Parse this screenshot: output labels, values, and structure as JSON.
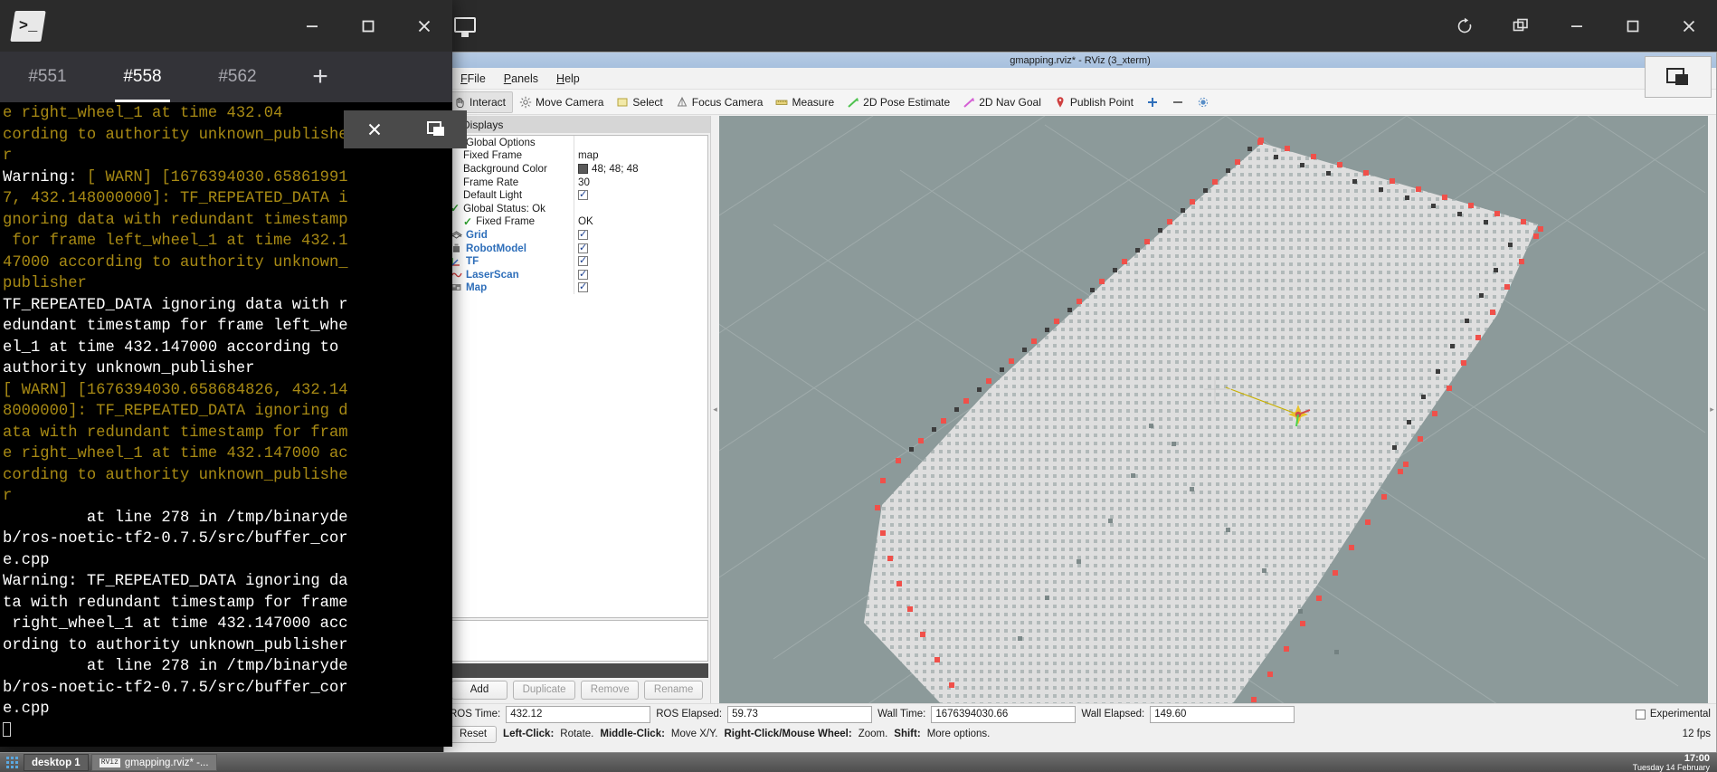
{
  "terminal": {
    "title_icon": "terminal-prompt-icon",
    "window_controls": {
      "minimize": "minimize-icon",
      "maximize": "maximize-icon",
      "close": "close-icon"
    },
    "tabs": [
      {
        "label": "#551",
        "active": false
      },
      {
        "label": "#558",
        "active": true
      },
      {
        "label": "#562",
        "active": false
      }
    ],
    "new_tab_label": "+",
    "overlay_buttons": [
      {
        "name": "close-overlay",
        "glyph": "✕"
      },
      {
        "name": "restore-overlay",
        "glyph": "❐"
      }
    ],
    "lines": [
      {
        "t": "e right_wheel_1 at time 432.04",
        "c": "y"
      },
      {
        "t": "cording to authority unknown_publisher",
        "c": "y"
      },
      {
        "t": "r",
        "c": "y"
      },
      {
        "t": "Warning: ",
        "c": "w",
        "t2": "[ WARN] [1676394030.65861991",
        "c2": "y"
      },
      {
        "t": "7, 432.148000000]: TF_REPEATED_DATA i",
        "c": "y"
      },
      {
        "t": "gnoring data with redundant timestamp",
        "c": "y"
      },
      {
        "t": " for frame left_wheel_1 at time 432.1",
        "c": "y"
      },
      {
        "t": "47000 according to authority unknown_",
        "c": "y"
      },
      {
        "t": "publisher",
        "c": "y"
      },
      {
        "t": "TF_REPEATED_DATA ignoring data with r",
        "c": "w"
      },
      {
        "t": "edundant timestamp for frame left_whe",
        "c": "w"
      },
      {
        "t": "el_1 at time 432.147000 according to",
        "c": "w"
      },
      {
        "t": "authority unknown_publisher",
        "c": "w"
      },
      {
        "t": "[ WARN] [1676394030.658684826, 432.14",
        "c": "y"
      },
      {
        "t": "8000000]: TF_REPEATED_DATA ignoring d",
        "c": "y"
      },
      {
        "t": "ata with redundant timestamp for fram",
        "c": "y"
      },
      {
        "t": "e right_wheel_1 at time 432.147000 ac",
        "c": "y"
      },
      {
        "t": "cording to authority unknown_publishe",
        "c": "y"
      },
      {
        "t": "r",
        "c": "y"
      },
      {
        "t": "         at line 278 in /tmp/binaryde",
        "c": "w"
      },
      {
        "t": "b/ros-noetic-tf2-0.7.5/src/buffer_cor",
        "c": "w"
      },
      {
        "t": "e.cpp",
        "c": "w"
      },
      {
        "t": "Warning: TF_REPEATED_DATA ignoring da",
        "c": "w"
      },
      {
        "t": "ta with redundant timestamp for frame",
        "c": "w"
      },
      {
        "t": " right_wheel_1 at time 432.147000 acc",
        "c": "w"
      },
      {
        "t": "ording to authority unknown_publisher",
        "c": "w"
      },
      {
        "t": "         at line 278 in /tmp/binaryde",
        "c": "w"
      },
      {
        "t": "b/ros-noetic-tf2-0.7.5/src/buffer_cor",
        "c": "w"
      },
      {
        "t": "e.cpp",
        "c": "w"
      }
    ]
  },
  "rviz": {
    "window_title": "gmapping.rviz* - RViz (3_xterm)",
    "window_controls": {
      "refresh": "refresh-icon",
      "duplicate": "duplicate-window-icon",
      "minimize": "minimize-icon",
      "maximize": "maximize-icon",
      "close": "close-icon"
    },
    "menu": [
      {
        "label": "File",
        "accel": "F"
      },
      {
        "label": "Panels",
        "accel": "P"
      },
      {
        "label": "Help",
        "accel": "H"
      }
    ],
    "toolbar": [
      {
        "label": "Interact",
        "icon": "hand-icon",
        "active": true
      },
      {
        "label": "Move Camera",
        "icon": "camera-move-icon",
        "active": false
      },
      {
        "label": "Select",
        "icon": "select-rect-icon",
        "active": false
      },
      {
        "label": "Focus Camera",
        "icon": "focus-icon",
        "active": false
      },
      {
        "label": "Measure",
        "icon": "ruler-icon",
        "active": false
      },
      {
        "label": "2D Pose Estimate",
        "icon": "pose-arrow-icon",
        "active": false
      },
      {
        "label": "2D Nav Goal",
        "icon": "nav-goal-icon",
        "active": false
      },
      {
        "label": "Publish Point",
        "icon": "publish-point-icon",
        "active": false
      },
      {
        "label": "",
        "icon": "plus-circle-icon",
        "active": false
      },
      {
        "label": "",
        "icon": "minus-icon",
        "active": false
      },
      {
        "label": "",
        "icon": "gear-dot-icon",
        "active": false
      }
    ],
    "displays_panel": {
      "title": "Displays",
      "rows": [
        {
          "name": "Global Options",
          "value": "",
          "indent": 0,
          "icon": "gear-icon",
          "kind": "group"
        },
        {
          "name": "Fixed Frame",
          "value": "map",
          "indent": 1,
          "kind": "text"
        },
        {
          "name": "Background Color",
          "value": "48; 48; 48",
          "indent": 1,
          "kind": "color"
        },
        {
          "name": "Frame Rate",
          "value": "30",
          "indent": 1,
          "kind": "text"
        },
        {
          "name": "Default Light",
          "value": "",
          "indent": 1,
          "kind": "check",
          "checked": true
        },
        {
          "name": "Global Status: Ok",
          "value": "",
          "indent": 0,
          "kind": "status"
        },
        {
          "name": "Fixed Frame",
          "value": "OK",
          "indent": 1,
          "kind": "status-text"
        },
        {
          "name": "Grid",
          "value": "",
          "indent": 0,
          "kind": "display",
          "icon": "grid-icon",
          "checked": true
        },
        {
          "name": "RobotModel",
          "value": "",
          "indent": 0,
          "kind": "display",
          "icon": "robot-icon",
          "checked": true
        },
        {
          "name": "TF",
          "value": "",
          "indent": 0,
          "kind": "display",
          "icon": "tf-axes-icon",
          "checked": true
        },
        {
          "name": "LaserScan",
          "value": "",
          "indent": 0,
          "kind": "display",
          "icon": "laserscan-icon",
          "checked": true
        },
        {
          "name": "Map",
          "value": "",
          "indent": 0,
          "kind": "display",
          "icon": "map-icon",
          "checked": true
        }
      ],
      "buttons": [
        {
          "label": "Add",
          "enabled": true
        },
        {
          "label": "Duplicate",
          "enabled": false
        },
        {
          "label": "Remove",
          "enabled": false
        },
        {
          "label": "Rename",
          "enabled": false
        }
      ]
    },
    "time_panel": {
      "fields": [
        {
          "label": "ROS Time:",
          "value": "432.12"
        },
        {
          "label": "ROS Elapsed:",
          "value": "59.73"
        },
        {
          "label": "Wall Time:",
          "value": "1676394030.66"
        },
        {
          "label": "Wall Elapsed:",
          "value": "149.60"
        }
      ],
      "experimental_label": "Experimental",
      "experimental_checked": false
    },
    "status_bar": {
      "reset_label": "Reset",
      "hints": [
        {
          "bold": "Left-Click:",
          "text": "Rotate."
        },
        {
          "bold": "Middle-Click:",
          "text": "Move X/Y."
        },
        {
          "bold": "Right-Click/Mouse Wheel:",
          "text": "Zoom."
        },
        {
          "bold": "Shift:",
          "text": "More options."
        }
      ],
      "fps": "12 fps"
    }
  },
  "taskbar": {
    "launcher_icon": "app-grid-icon",
    "desktop_label": "desktop 1",
    "window_item": {
      "icon_text": "RViz",
      "label": "gmapping.rviz* -..."
    },
    "clock_time": "17:00",
    "clock_date": "Tuesday 14 February"
  }
}
